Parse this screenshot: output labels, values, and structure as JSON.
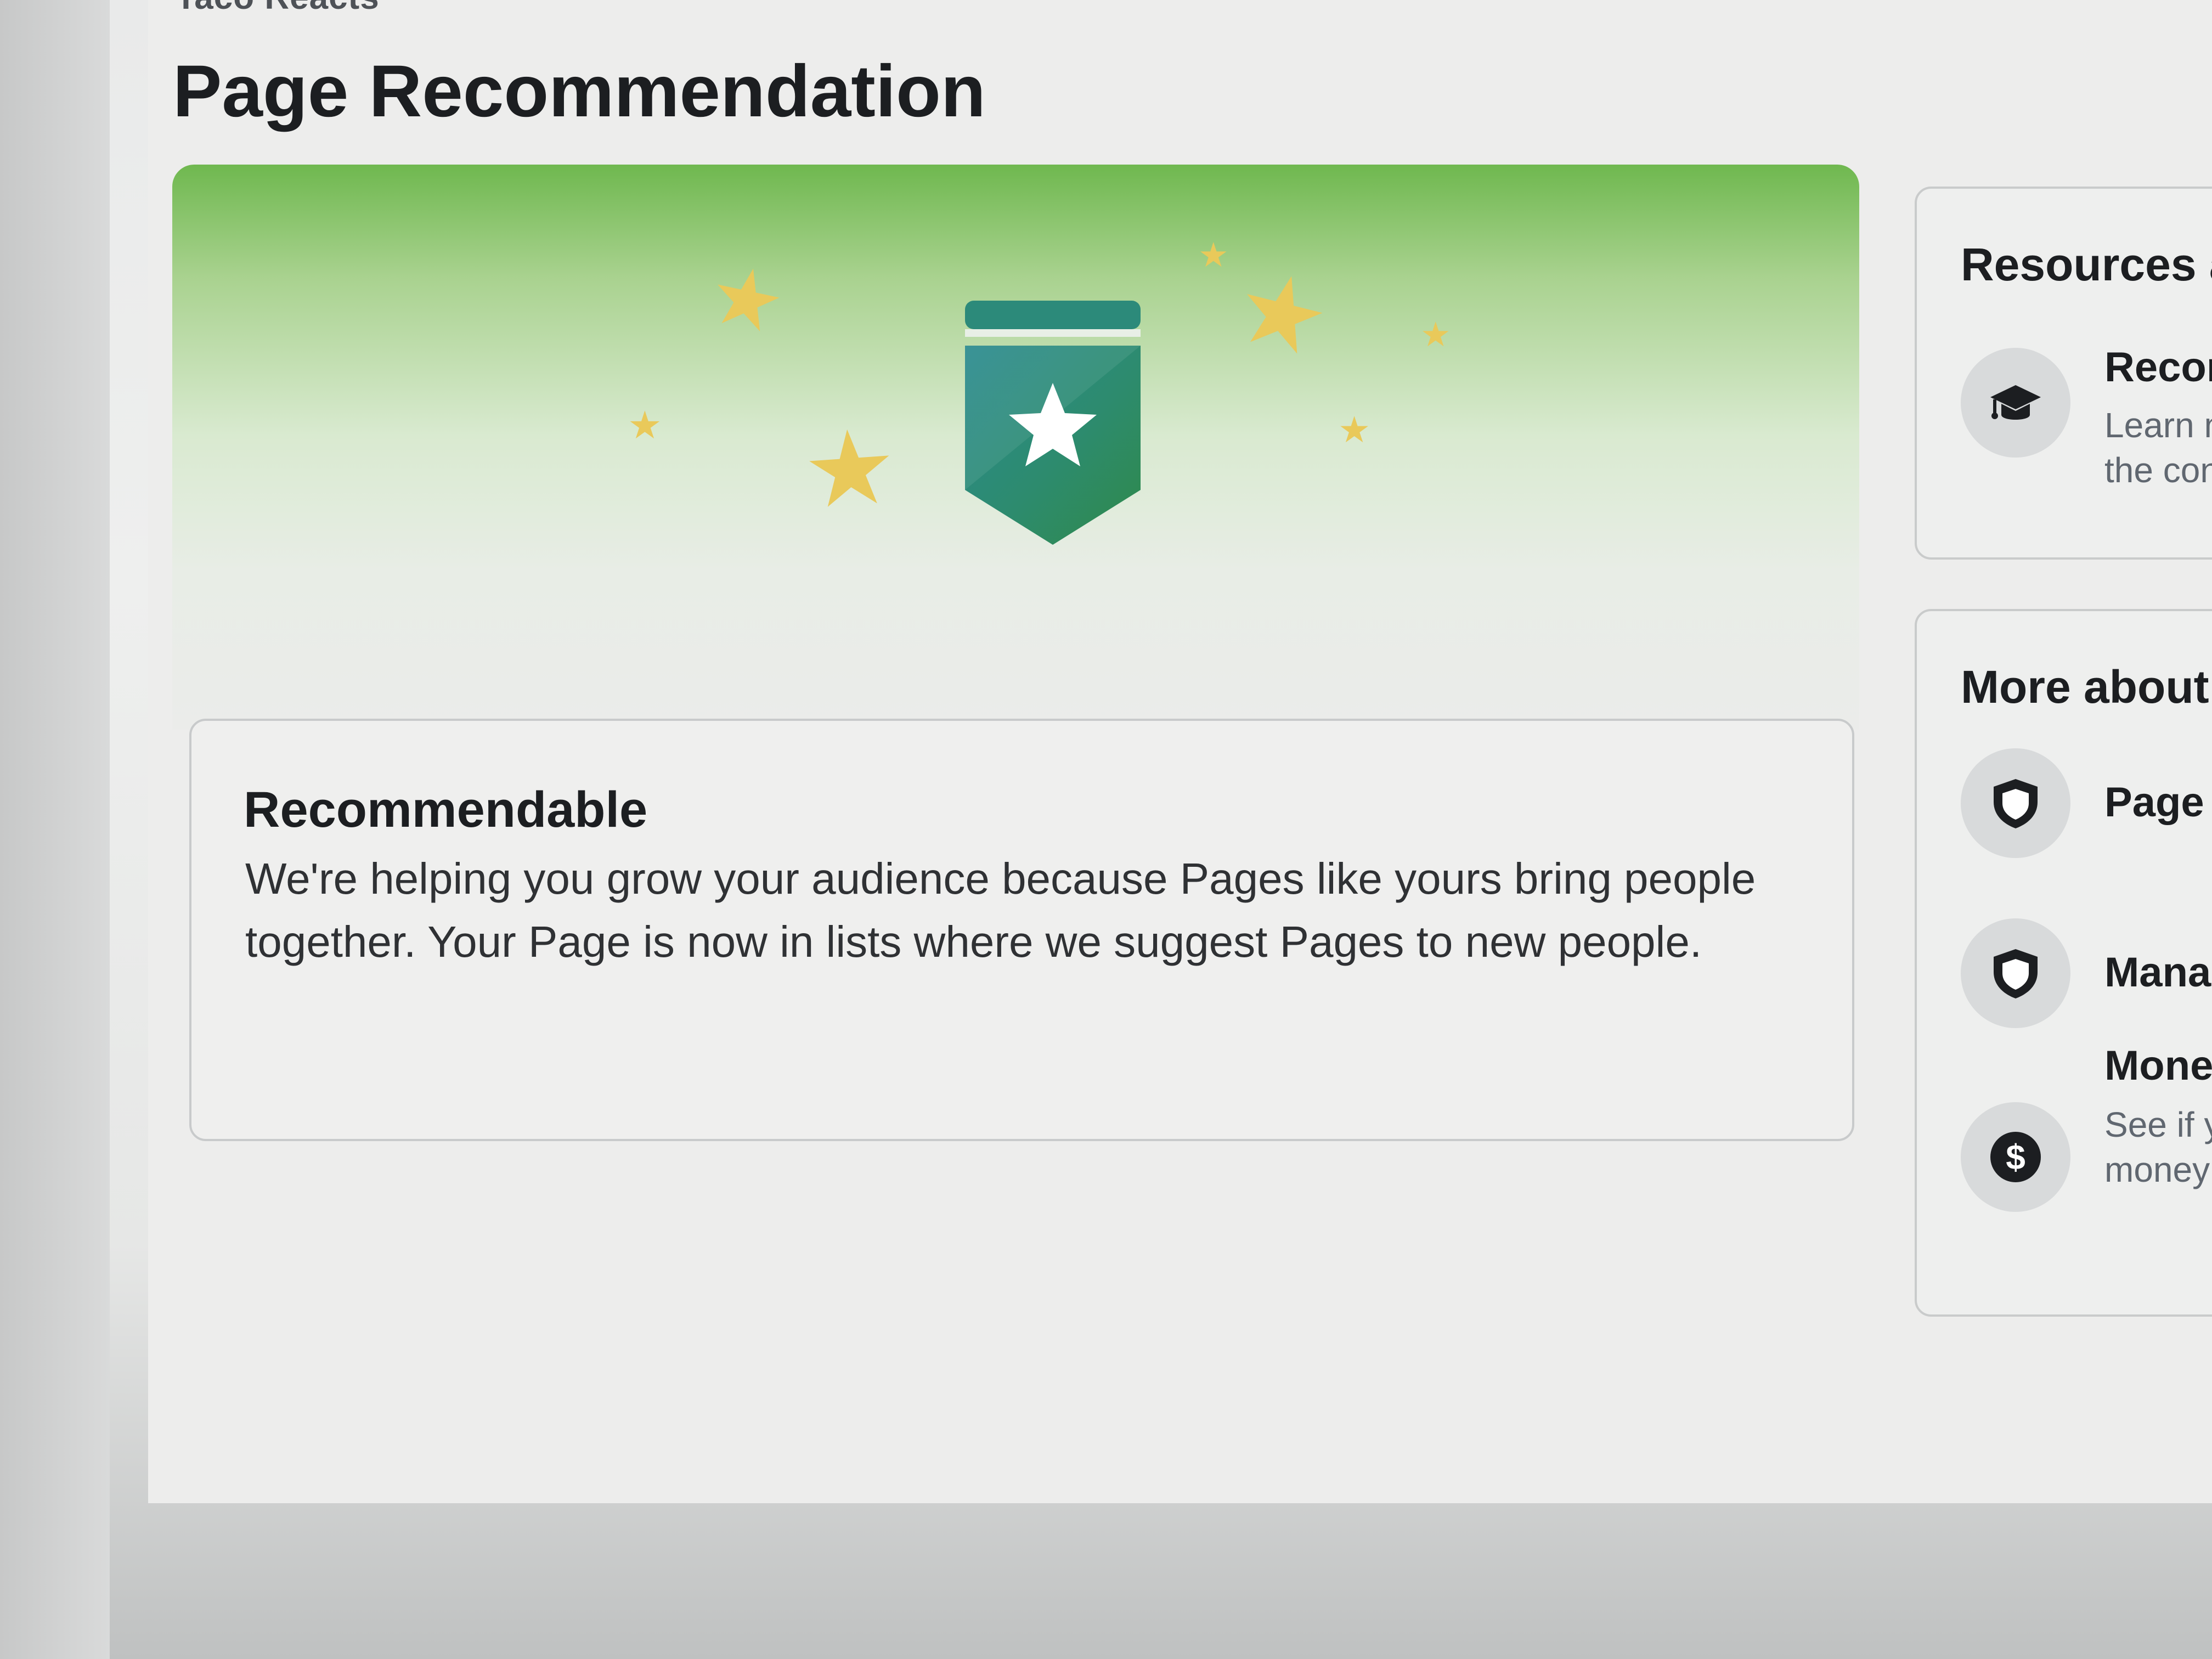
{
  "header": {
    "page_name": "Taco Reacts",
    "title": "Page Recommendation"
  },
  "status_card": {
    "title": "Recommendable",
    "body": "We're helping you grow your audience because Pages like yours bring people together. Your Page is now in lists where we suggest Pages to new people."
  },
  "resources": {
    "heading": "Resources a",
    "items": [
      {
        "icon": "graduation-cap-icon",
        "title": "Recom",
        "desc_line1": "Learn m",
        "desc_line2": "the con"
      }
    ]
  },
  "more_about": {
    "heading": "More about",
    "items": [
      {
        "icon": "shield-icon",
        "title": "Page S"
      },
      {
        "icon": "shield-icon",
        "title": "Manag"
      },
      {
        "icon": "dollar-icon",
        "title": "Monet",
        "desc_line1": "See if yo",
        "desc_line2": "money"
      }
    ]
  },
  "colors": {
    "hero_green": "#6fb84f",
    "badge_teal": "#2d8b86",
    "badge_green": "#2f8a4f",
    "star_gold": "#e9c95a"
  }
}
